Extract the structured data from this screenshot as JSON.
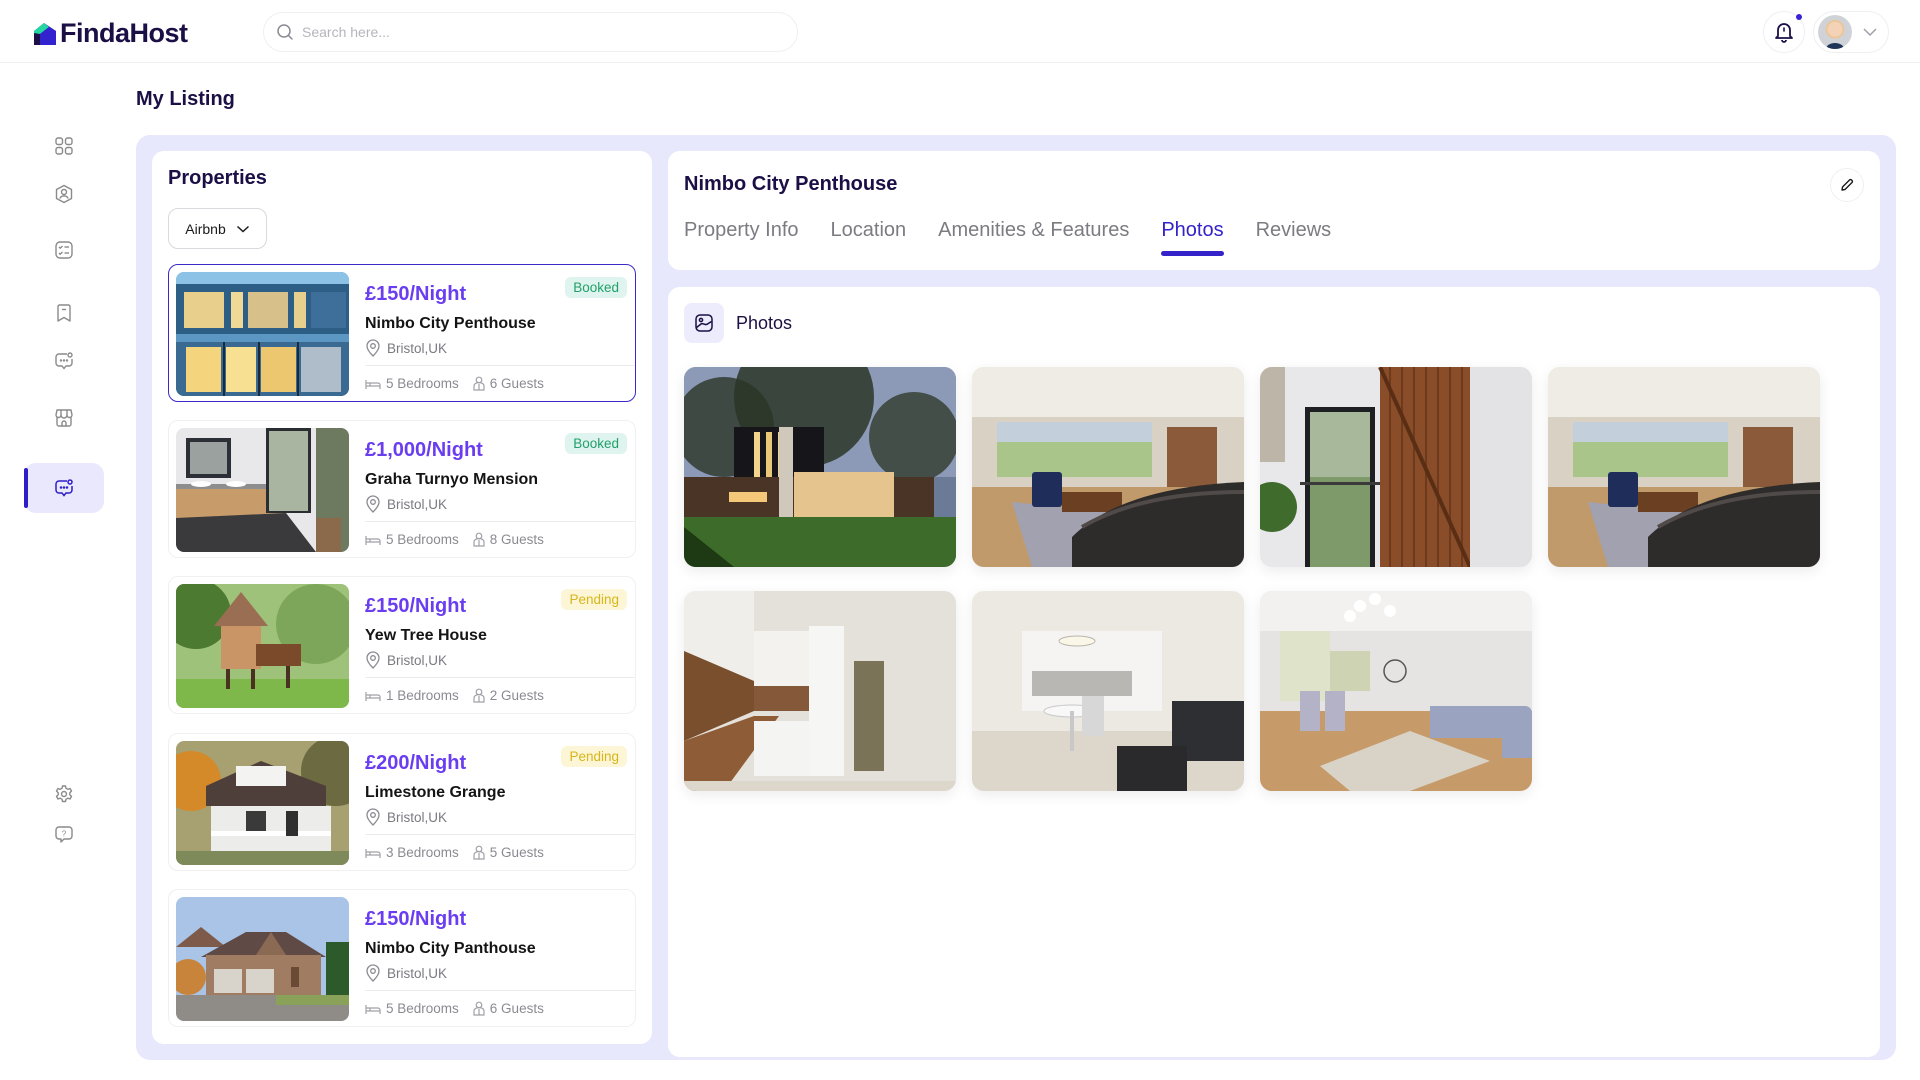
{
  "app": {
    "name": "FindaHost",
    "brand_color": "#2f1ec7",
    "accent_price_color": "#6a3df0"
  },
  "header": {
    "search_placeholder": "Search here...",
    "notification_icon": "bell-icon",
    "has_unread_notification": true,
    "profile_menu_icon": "chevron-down-icon"
  },
  "sidebar": {
    "items": [
      {
        "icon": "dashboard-grid-icon",
        "active": false
      },
      {
        "icon": "user-profile-icon",
        "active": false
      },
      {
        "icon": "checklist-icon",
        "active": false
      },
      {
        "icon": "bookmark-icon",
        "active": false
      },
      {
        "icon": "chat-bubble-icon",
        "active": false
      },
      {
        "icon": "store-icon",
        "active": false
      },
      {
        "icon": "chat-bubble-icon",
        "active": true
      }
    ],
    "bottom_items": [
      {
        "icon": "settings-gear-icon"
      },
      {
        "icon": "help-question-icon"
      }
    ]
  },
  "page": {
    "title": "My Listing"
  },
  "properties": {
    "title": "Properties",
    "filter": {
      "selected": "Airbnb"
    },
    "items": [
      {
        "price": "£150/Night",
        "name": "Nimbo City Penthouse",
        "location": "Bristol,UK",
        "bedrooms": "5 Bedrooms",
        "guests": "6 Guests",
        "status": "Booked",
        "selected": true
      },
      {
        "price": "£1,000/Night",
        "name": "Graha Turnyo Mension",
        "location": "Bristol,UK",
        "bedrooms": "5 Bedrooms",
        "guests": "8 Guests",
        "status": "Booked",
        "selected": false
      },
      {
        "price": "£150/Night",
        "name": "Yew Tree House",
        "location": "Bristol,UK",
        "bedrooms": "1 Bedrooms",
        "guests": "2 Guests",
        "status": "Pending",
        "selected": false
      },
      {
        "price": "£200/Night",
        "name": "Limestone Grange",
        "location": "Bristol,UK",
        "bedrooms": "3 Bedrooms",
        "guests": "5 Guests",
        "status": "Pending",
        "selected": false
      },
      {
        "price": "£150/Night",
        "name": "Nimbo City Panthouse",
        "location": "Bristol,UK",
        "bedrooms": "5 Bedrooms",
        "guests": "6 Guests",
        "status": "",
        "selected": false
      }
    ]
  },
  "detail": {
    "title": "Nimbo City Penthouse",
    "tabs": [
      {
        "label": "Property Info",
        "active": false
      },
      {
        "label": "Location",
        "active": false
      },
      {
        "label": "Amenities & Features",
        "active": false
      },
      {
        "label": "Photos",
        "active": true
      },
      {
        "label": "Reviews",
        "active": false
      }
    ],
    "photos_section": {
      "title": "Photos",
      "photos": [
        {
          "subject": "modern house exterior with tree at dusk"
        },
        {
          "subject": "living room with leather sofa and large windows"
        },
        {
          "subject": "wooden slat staircase with glass balustrade"
        },
        {
          "subject": "living room with leather sofa and large windows"
        },
        {
          "subject": "kitchen with wooden countertop and white cabinets"
        },
        {
          "subject": "white dining area with round table"
        },
        {
          "subject": "open-plan living room with grey sofa and rug"
        }
      ]
    }
  }
}
